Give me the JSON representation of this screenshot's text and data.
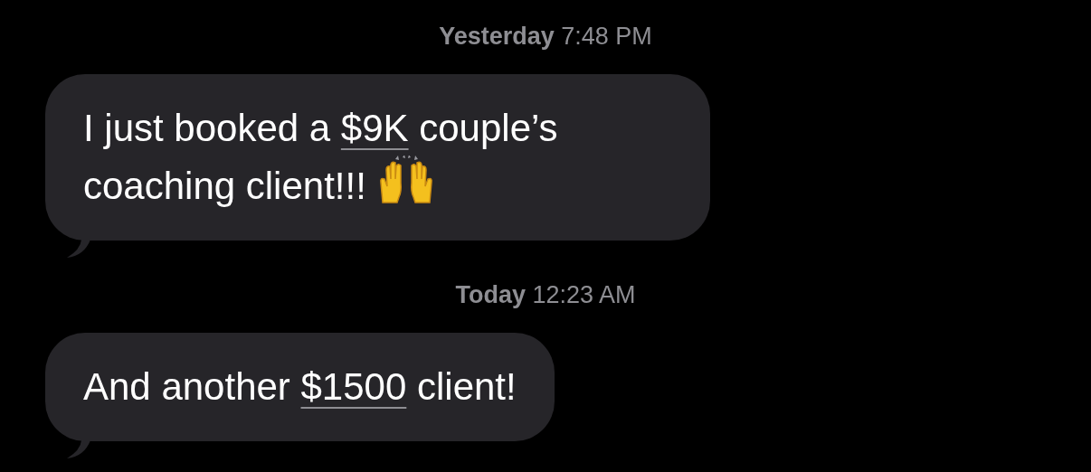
{
  "messages": [
    {
      "timestamp": "**Yesterday** 7:48 PM",
      "parts": [
        {
          "kind": "text",
          "text": "I just booked a "
        },
        {
          "kind": "link",
          "text": "$9K"
        },
        {
          "kind": "text",
          "text": " couple’s coaching client!!! "
        },
        {
          "kind": "emoji"
        }
      ]
    },
    {
      "timestamp": "**Today** 12:23 AM",
      "parts": [
        {
          "kind": "text",
          "text": "And another "
        },
        {
          "kind": "link",
          "text": "$1500"
        },
        {
          "kind": "text",
          "text": " client!"
        }
      ]
    }
  ]
}
